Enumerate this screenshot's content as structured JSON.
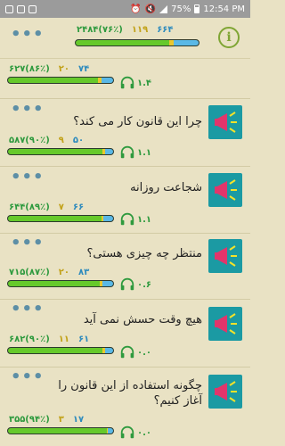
{
  "status_bar": {
    "battery": "75%",
    "time": "12:54 PM"
  },
  "header": {
    "menu_icon": "more-dots-icon",
    "info_icon": "info-icon",
    "info_label": "i",
    "stats": {
      "blue": "۶۶۴",
      "yellow": "۱۱۹",
      "green": "۲۴۸۴(۷۶٪)"
    },
    "bar": {
      "green": 0.76,
      "yellow": 0.04,
      "blue": 0.2
    }
  },
  "items": [
    {
      "question": "",
      "stats": {
        "blue": "۷۴",
        "yellow": "۲۰",
        "green": "۶۲۷(۸۶٪)"
      },
      "bar": {
        "green": 0.86,
        "yellow": 0.03,
        "blue": 0.11
      },
      "audio": "۱.۴"
    },
    {
      "question": "چرا این قانون کار می کند؟",
      "stats": {
        "blue": "۵۰",
        "yellow": "۹",
        "green": "۵۸۷(۹۰٪)"
      },
      "bar": {
        "green": 0.9,
        "yellow": 0.02,
        "blue": 0.08
      },
      "audio": "۱.۱"
    },
    {
      "question": "شجاعت روزانه",
      "stats": {
        "blue": "۶۶",
        "yellow": "۷",
        "green": "۶۴۴(۸۹٪)"
      },
      "bar": {
        "green": 0.89,
        "yellow": 0.02,
        "blue": 0.09
      },
      "audio": "۱.۱"
    },
    {
      "question": "منتظر چه چیزی هستی؟",
      "stats": {
        "blue": "۸۳",
        "yellow": "۲۰",
        "green": "۷۱۵(۸۷٪)"
      },
      "bar": {
        "green": 0.87,
        "yellow": 0.03,
        "blue": 0.1
      },
      "audio": "۰.۶"
    },
    {
      "question": "هیچ وقت حسش نمی آید",
      "stats": {
        "blue": "۶۱",
        "yellow": "۱۱",
        "green": "۶۸۲(۹۰٪)"
      },
      "bar": {
        "green": 0.9,
        "yellow": 0.02,
        "blue": 0.08
      },
      "audio": "۰.۰"
    },
    {
      "question_line1": "چگونه استفاده از این قانون را",
      "question_line2": "آغاز کنیم؟",
      "stats": {
        "blue": "۱۷",
        "yellow": "۳",
        "green": "۳۵۵(۹۴٪)"
      },
      "bar": {
        "green": 0.94,
        "yellow": 0.01,
        "blue": 0.05
      },
      "audio": "۰.۰"
    }
  ]
}
